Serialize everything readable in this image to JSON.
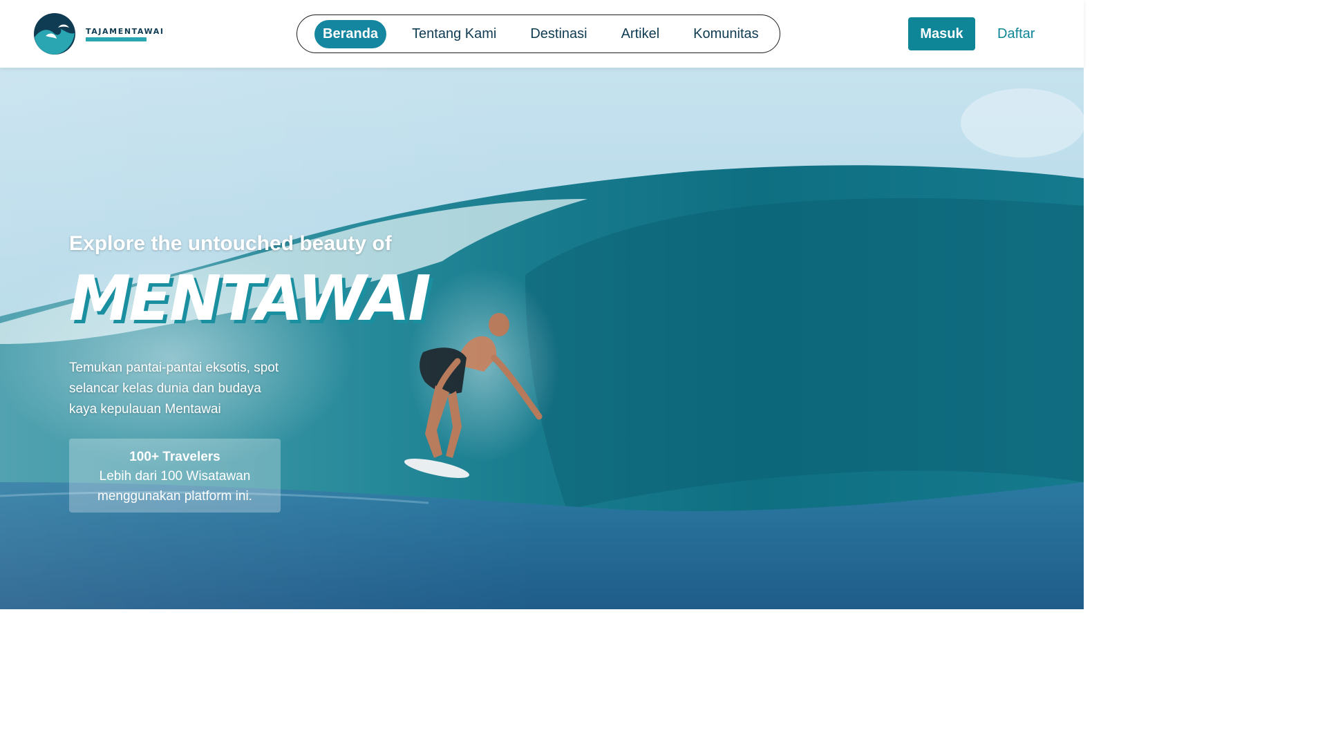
{
  "brand": {
    "name": "TAJAMENTAWAI",
    "logo_icon": "wave-logo-icon",
    "colors": {
      "primary": "#0f8598",
      "dark": "#0f3b53",
      "accent": "#2aa6b2"
    }
  },
  "nav": {
    "items": [
      {
        "label": "Beranda",
        "active": true
      },
      {
        "label": "Tentang Kami",
        "active": false
      },
      {
        "label": "Destinasi",
        "active": false
      },
      {
        "label": "Artikel",
        "active": false
      },
      {
        "label": "Komunitas",
        "active": false
      }
    ]
  },
  "auth": {
    "login_label": "Masuk",
    "register_label": "Daftar"
  },
  "hero": {
    "subtitle": "Explore the untouched beauty of",
    "title": "MENTAWAI",
    "description": "Temukan pantai-pantai eksotis, spot selancar kelas dunia dan budaya kaya kepulauan Mentawai",
    "stat": {
      "title": "100+ Travelers",
      "description": "Lebih dari 100 Wisatawan menggunakan platform ini."
    }
  }
}
